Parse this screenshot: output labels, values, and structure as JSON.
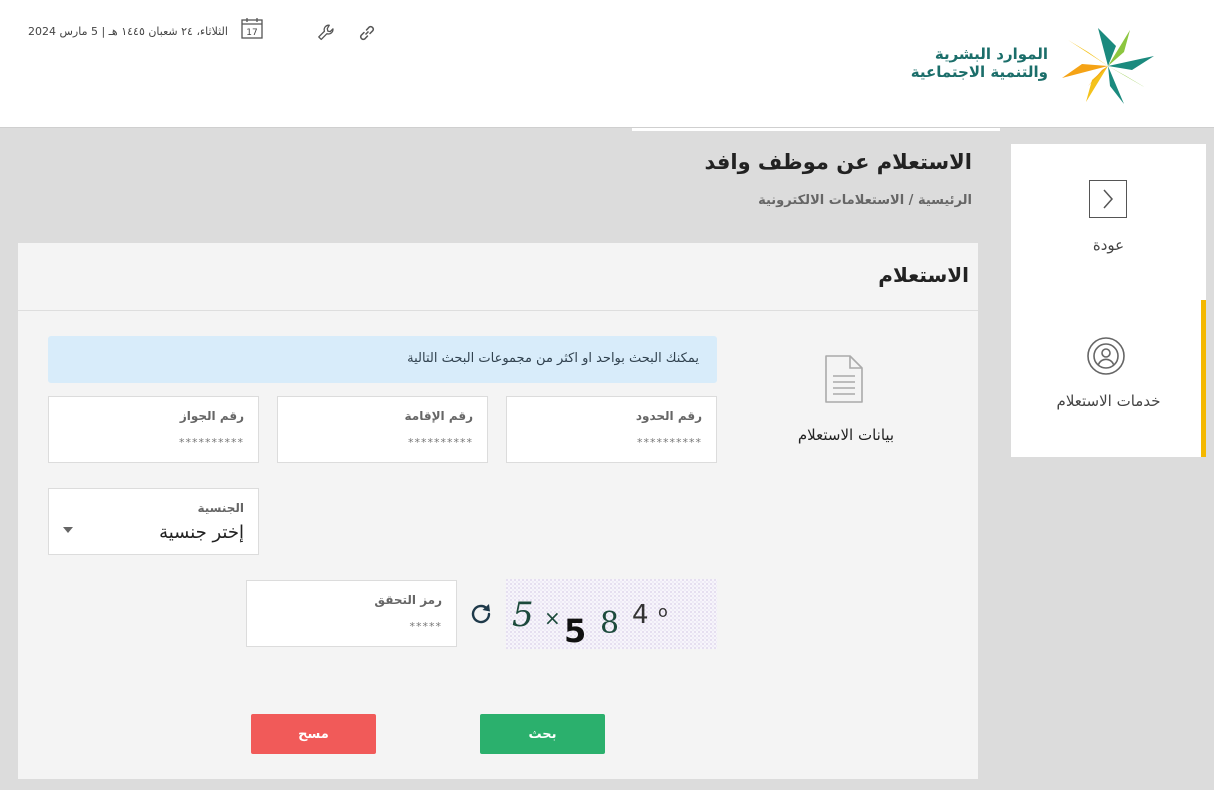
{
  "header": {
    "date": "الثلاثاء، ٢٤ شعبان ١٤٤٥ هـ | 5 مارس 2024",
    "calendar_day": "17",
    "logo_line1": "الموارد البشرية",
    "logo_line2": "والتنمية الاجتماعية",
    "icons": [
      "calendar-icon",
      "wrench-icon",
      "link-icon"
    ],
    "logo_colors": {
      "teal": "#1b8a7e",
      "orange": "#f5a316",
      "yellow": "#f4c21b",
      "green": "#8cc63f"
    }
  },
  "page": {
    "title": "الاستعلام عن موظف وافد",
    "breadcrumb": "الرئيسية / الاستعلامات الالكترونية"
  },
  "sidebar": {
    "back_label": "عودة",
    "services_label": "خدمات الاستعلام",
    "active_color": "#f4b800"
  },
  "card": {
    "title": "الاستعلام",
    "info": "يمكنك البحث بواحد او اكثر من مجموعات البحث التالية",
    "doc_label": "بيانات الاستعلام",
    "fields": {
      "border_no": {
        "label": "رقم الحدود",
        "value": "**********"
      },
      "iqama_no": {
        "label": "رقم الإقامة",
        "value": "**********"
      },
      "passport_no": {
        "label": "رقم الجواز",
        "value": "**********"
      },
      "nationality": {
        "label": "الجنسية",
        "value": "إختر جنسية"
      },
      "captcha_code": {
        "label": "رمز التحقق",
        "value": "*****"
      }
    },
    "captcha_text": "5×584⁰",
    "buttons": {
      "search": "بحث",
      "clear": "مسح"
    },
    "colors": {
      "search": "#2bb06d",
      "clear": "#f15a59",
      "info_bg": "#d8ecfa"
    }
  }
}
